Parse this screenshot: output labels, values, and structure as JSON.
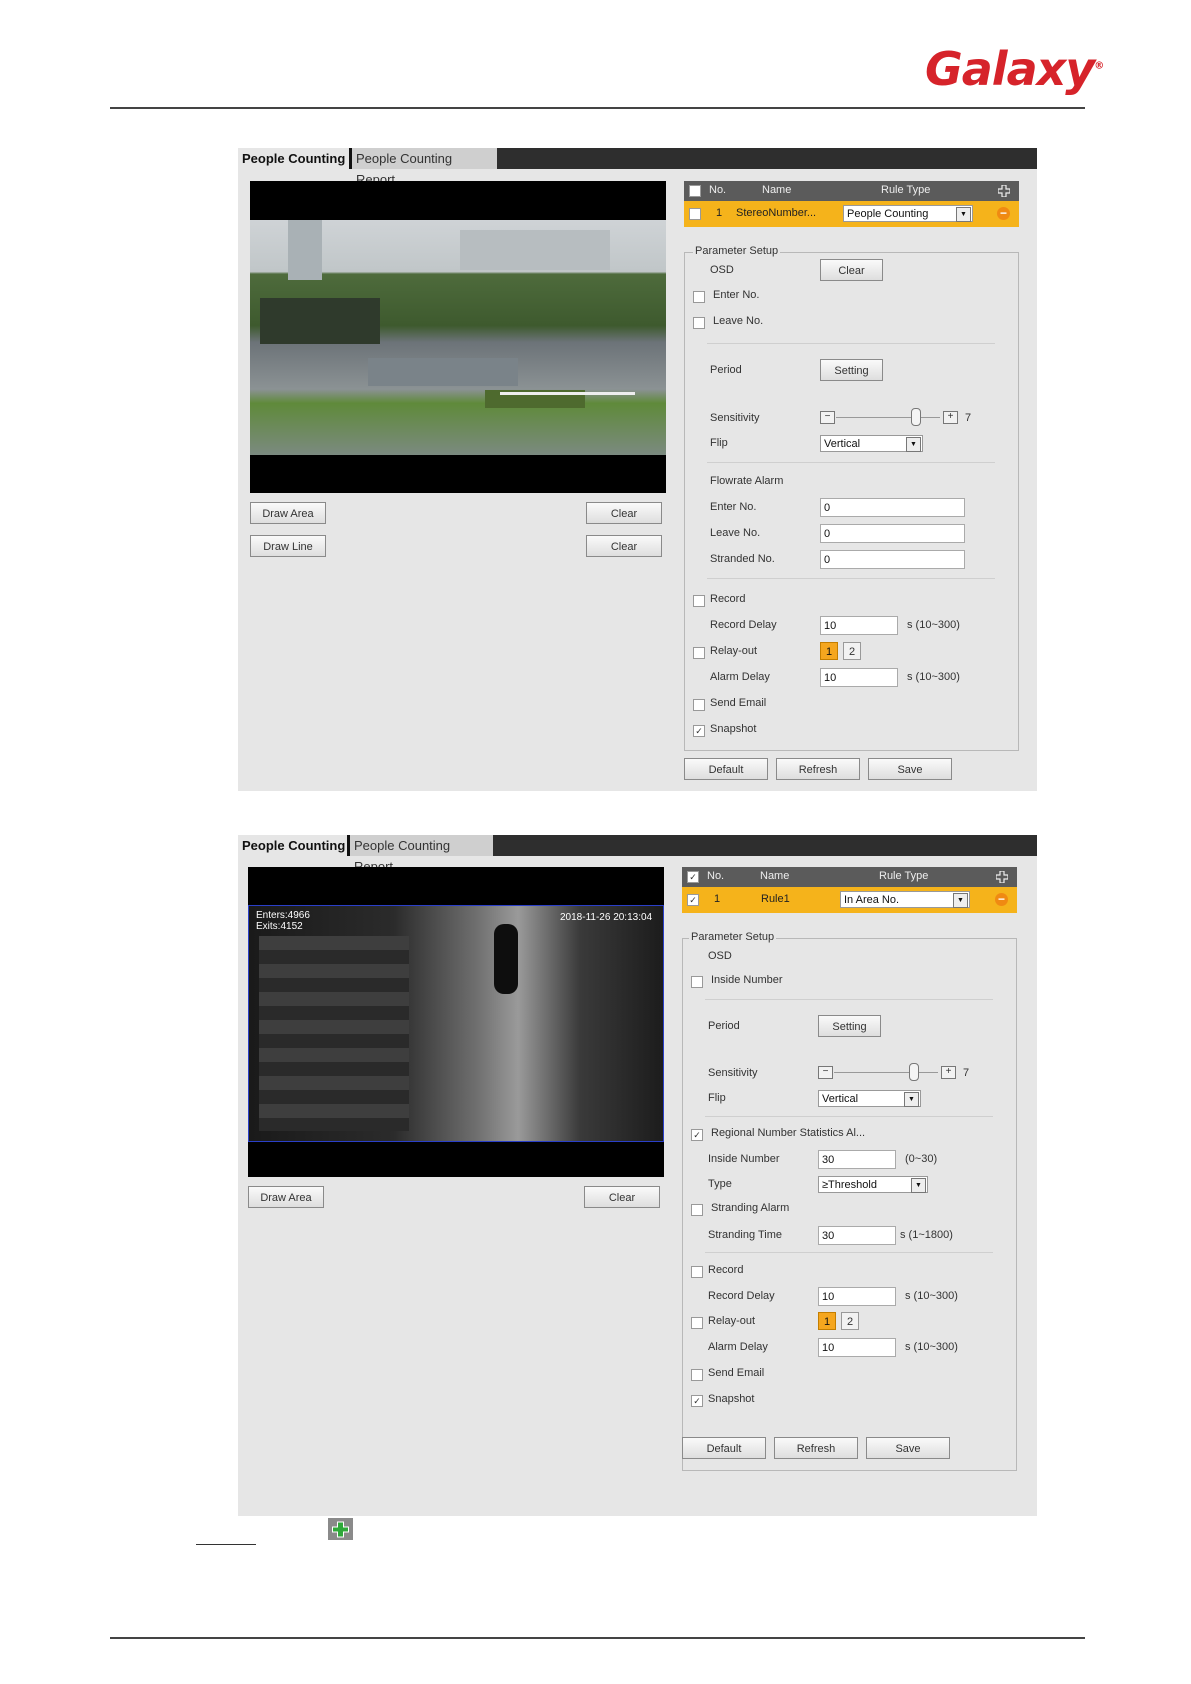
{
  "header": {
    "brand": "Galaxy",
    "trademark": "®"
  },
  "panel1": {
    "tabs": [
      "People Counting",
      "People Counting Report"
    ],
    "video": {
      "buttons": [
        {
          "left": "Draw Area",
          "right": "Clear"
        },
        {
          "left": "Draw Line",
          "right": "Clear"
        }
      ]
    },
    "rule_table": {
      "headers": [
        "No.",
        "Name",
        "Rule Type"
      ],
      "row": {
        "no": "1",
        "name": "StereoNumber...",
        "rule_type": "People Counting",
        "checked": false
      }
    },
    "param": {
      "legend": "Parameter Setup",
      "osd": "OSD",
      "osd_clear": "Clear",
      "enter_no": "Enter No.",
      "leave_no": "Leave No.",
      "period": "Period",
      "period_btn": "Setting",
      "sensitivity": "Sensitivity",
      "sensitivity_value": "7",
      "sensitivity_level": 0.75,
      "flip": "Flip",
      "flip_value": "Vertical",
      "flowrate_alarm": "Flowrate Alarm",
      "fa_enter": "Enter No.",
      "fa_enter_value": "0",
      "fa_leave": "Leave No.",
      "fa_leave_value": "0",
      "fa_stranded": "Stranded No.",
      "fa_stranded_value": "0",
      "record": "Record",
      "record_delay": "Record Delay",
      "record_delay_value": "10",
      "record_delay_unit": "s (10~300)",
      "relay_out": "Relay-out",
      "relay_1": "1",
      "relay_2": "2",
      "alarm_delay": "Alarm Delay",
      "alarm_delay_value": "10",
      "alarm_delay_unit": "s (10~300)",
      "send_email": "Send Email",
      "snapshot": "Snapshot",
      "snapshot_check": "✓"
    },
    "footer": [
      "Default",
      "Refresh",
      "Save"
    ]
  },
  "panel2": {
    "tabs": [
      "People Counting",
      "People Counting Report"
    ],
    "video": {
      "overlay_line1": "Enters:4966",
      "overlay_line2": "Exits:4152",
      "timestamp": "2018-11-26 20:13:04",
      "buttons": [
        {
          "left": "Draw Area",
          "right": "Clear"
        }
      ]
    },
    "rule_table": {
      "headers": [
        "No.",
        "Name",
        "Rule Type"
      ],
      "header_check": "✓",
      "row": {
        "no": "1",
        "name": "Rule1",
        "rule_type": "In Area No.",
        "check": "✓"
      }
    },
    "param": {
      "legend": "Parameter Setup",
      "osd": "OSD",
      "inside_number": "Inside Number",
      "period": "Period",
      "period_btn": "Setting",
      "sensitivity": "Sensitivity",
      "sensitivity_value": "7",
      "sensitivity_level": 0.75,
      "flip": "Flip",
      "flip_value": "Vertical",
      "regional": "Regional Number Statistics Al...",
      "regional_check": "✓",
      "inside_number2": "Inside Number",
      "inside_number_value": "30",
      "inside_number_unit": "(0~30)",
      "type": "Type",
      "type_value": "≥Threshold",
      "stranding_alarm": "Stranding Alarm",
      "stranding_time": "Stranding Time",
      "stranding_time_value": "30",
      "stranding_time_unit": "s (1~1800)",
      "record": "Record",
      "record_delay": "Record Delay",
      "record_delay_value": "10",
      "record_delay_unit": "s (10~300)",
      "relay_out": "Relay-out",
      "relay_1": "1",
      "relay_2": "2",
      "alarm_delay": "Alarm Delay",
      "alarm_delay_value": "10",
      "alarm_delay_unit": "s (10~300)",
      "send_email": "Send Email",
      "snapshot": "Snapshot",
      "snapshot_check": "✓"
    },
    "footer": [
      "Default",
      "Refresh",
      "Save"
    ]
  },
  "colors": {
    "brand": "#d6232a",
    "rule_row": "#f5b31b",
    "relay_on": "#f5a61e",
    "delete": "#f08a12",
    "add": "#2fa83a"
  },
  "icons": [
    "add-rule-icon",
    "delete-rule-icon",
    "add-icon"
  ]
}
